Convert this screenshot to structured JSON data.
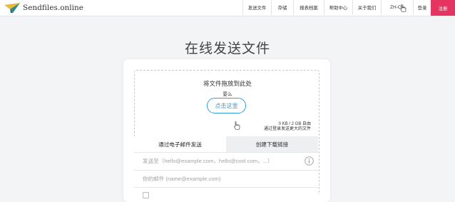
{
  "header": {
    "brand": "Sendfiles.online",
    "nav": [
      "发送文件",
      "存储",
      "报表档案",
      "帮助中心",
      "关于我们",
      "ZH-CN",
      "登录",
      "注册"
    ],
    "accent": "#e5345f"
  },
  "main": {
    "title": "在线发送文件",
    "drop_text": "将文件拖放到此处",
    "or_text": "要么",
    "click_button": "点击这里",
    "size_limit": "0 KB / 2 GB 自由",
    "size_hint": "通过登录发送更大的文件",
    "tabs": [
      "通过电子邮件发送",
      "创建下载链接"
    ],
    "send_to_placeholder": "发送至（hello@example.com，hello@cool.com，...）",
    "your_email_placeholder": "你的邮件 (name@example.com)",
    "checkbox_label": "",
    "link_color": "#2f9fe0"
  }
}
